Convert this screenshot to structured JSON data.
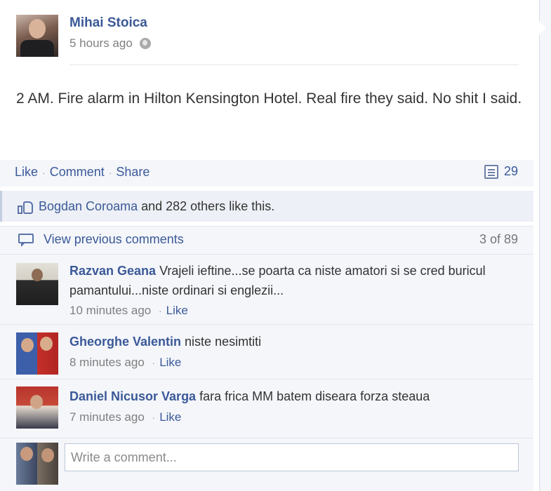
{
  "post": {
    "author": "Mihai Stoica",
    "timestamp": "5 hours ago",
    "privacy_icon": "globe-icon",
    "text": "2 AM. Fire alarm in Hilton Kensington Hotel. Real fire they said. No shit I said."
  },
  "actions": {
    "like": "Like",
    "comment": "Comment",
    "share": "Share",
    "comment_count": "29"
  },
  "likes": {
    "name": "Bogdan Coroama",
    "rest": " and 282 others like this."
  },
  "comments_nav": {
    "view_previous": "View previous comments",
    "pager": "3 of 89"
  },
  "comments": [
    {
      "author": "Razvan Geana",
      "text": "Vrajeli ieftine...se poarta ca niste amatori si se cred buricul pamantului...niste ordinari si englezii...",
      "time": "10 minutes ago",
      "like": "Like"
    },
    {
      "author": "Gheorghe Valentin",
      "text": "niste nesimtiti",
      "time": "8 minutes ago",
      "like": "Like"
    },
    {
      "author": "Daniel Nicusor Varga",
      "text": "fara frica MM batem diseara forza steaua",
      "time": "7 minutes ago",
      "like": "Like"
    }
  ],
  "compose": {
    "placeholder": "Write a comment..."
  },
  "colors": {
    "link": "#3b5998",
    "panel": "#f4f6fa",
    "likes_panel": "#edf0f6"
  }
}
